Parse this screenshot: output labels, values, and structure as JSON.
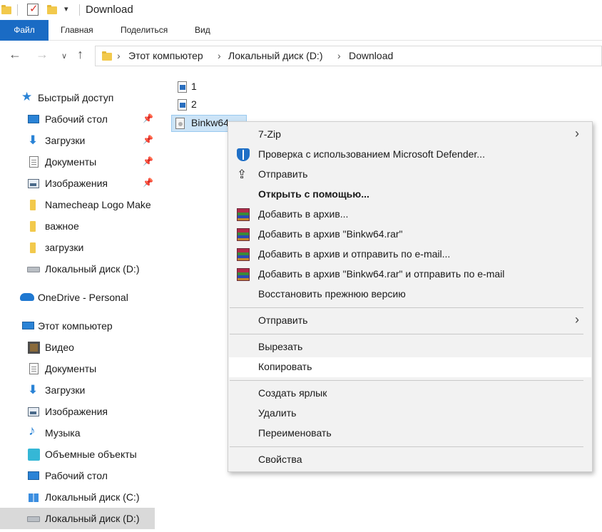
{
  "window": {
    "title": "Download"
  },
  "ribbon": {
    "tabs": [
      "Файл",
      "Главная",
      "Поделиться",
      "Вид"
    ]
  },
  "address": {
    "crumbs": [
      "Этот компьютер",
      "Локальный диск (D:)",
      "Download"
    ]
  },
  "sidebar": {
    "quick_access": "Быстрый доступ",
    "quick_items": [
      {
        "label": "Рабочий стол",
        "icon": "desktop-icon",
        "pinned": true
      },
      {
        "label": "Загрузки",
        "icon": "download-icon",
        "pinned": true
      },
      {
        "label": "Документы",
        "icon": "documents-icon",
        "pinned": true
      },
      {
        "label": "Изображения",
        "icon": "pictures-icon",
        "pinned": true
      },
      {
        "label": "Namecheap Logo Make",
        "icon": "folder-icon",
        "pinned": false
      },
      {
        "label": "важное",
        "icon": "folder-icon",
        "pinned": false
      },
      {
        "label": "загрузки",
        "icon": "folder-icon",
        "pinned": false
      },
      {
        "label": "Локальный диск (D:)",
        "icon": "drive-icon",
        "pinned": false
      }
    ],
    "onedrive": "OneDrive - Personal",
    "this_pc": "Этот компьютер",
    "pc_items": [
      {
        "label": "Видео",
        "icon": "video-icon"
      },
      {
        "label": "Документы",
        "icon": "documents-icon"
      },
      {
        "label": "Загрузки",
        "icon": "download-icon"
      },
      {
        "label": "Изображения",
        "icon": "pictures-icon"
      },
      {
        "label": "Музыка",
        "icon": "music-icon"
      },
      {
        "label": "Объемные объекты",
        "icon": "3d-objects-icon"
      },
      {
        "label": "Рабочий стол",
        "icon": "desktop-icon"
      },
      {
        "label": "Локальный диск (C:)",
        "icon": "windows-drive-icon"
      },
      {
        "label": "Локальный диск (D:)",
        "icon": "drive-icon"
      }
    ]
  },
  "files": [
    {
      "name": "1",
      "selected": false
    },
    {
      "name": "2",
      "selected": false
    },
    {
      "name": "Binkw64",
      "selected": true
    }
  ],
  "context_menu": {
    "items": [
      {
        "label": "7-Zip",
        "submenu": true,
        "icon": ""
      },
      {
        "label": "Проверка с использованием Microsoft Defender...",
        "icon": "defender-shield-icon"
      },
      {
        "label": "Отправить",
        "icon": "share-icon"
      },
      {
        "label": "Открыть с помощью...",
        "bold": true,
        "icon": ""
      },
      {
        "label": "Добавить в архив...",
        "icon": "winrar-icon"
      },
      {
        "label": "Добавить в архив \"Binkw64.rar\"",
        "icon": "winrar-icon"
      },
      {
        "label": "Добавить в архив и отправить по e-mail...",
        "icon": "winrar-icon"
      },
      {
        "label": "Добавить в архив \"Binkw64.rar\" и отправить по e-mail",
        "icon": "winrar-icon"
      },
      {
        "label": "Восстановить прежнюю версию",
        "icon": ""
      },
      {
        "label": "Отправить",
        "submenu": true,
        "icon": ""
      },
      {
        "label": "Вырезать",
        "icon": ""
      },
      {
        "label": "Копировать",
        "hover": true,
        "icon": ""
      },
      {
        "label": "Создать ярлык",
        "icon": ""
      },
      {
        "label": "Удалить",
        "icon": ""
      },
      {
        "label": "Переименовать",
        "icon": ""
      },
      {
        "label": "Свойства",
        "icon": ""
      }
    ]
  },
  "colors": {
    "accent": "#1a6bc4",
    "selection": "#cce4f7",
    "menu_bg": "#f2f2f2"
  }
}
